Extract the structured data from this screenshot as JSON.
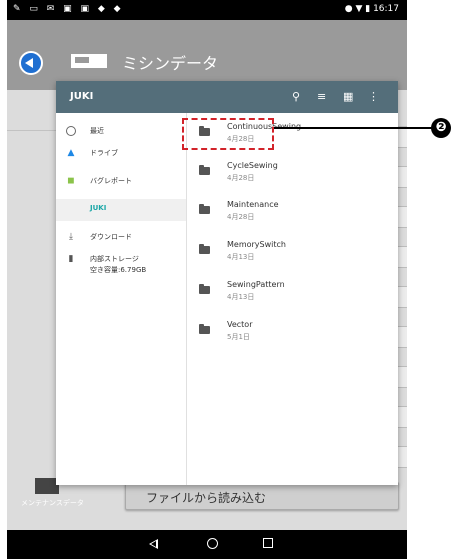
{
  "status_bar": {
    "left_icons": "✎ ▭ ✉ ▣ ▣ ◆ ◆",
    "time": "16:17"
  },
  "app": {
    "title": "ミシンデータ",
    "bottom_label": "メンテナンスデータ",
    "import_button": "ファイルから読み込む"
  },
  "dialog": {
    "title": "JUKI",
    "header_icons": [
      "search-icon",
      "sort-icon",
      "grid-icon",
      "more-icon"
    ],
    "drawer": [
      {
        "icon": "clock-icon",
        "label": "最近"
      },
      {
        "icon": "drive-icon",
        "label": "ドライブ"
      },
      {
        "icon": "android-icon",
        "label": "バグレポート"
      },
      {
        "icon": "",
        "label": "JUKI",
        "selected": true
      },
      {
        "icon": "download-icon",
        "label": "ダウンロード"
      },
      {
        "icon": "storage-icon",
        "label": "内部ストレージ",
        "sub": "空き容量:6.79GB"
      }
    ],
    "files": [
      {
        "name": "ContinuousSewing",
        "date": "4月28日"
      },
      {
        "name": "CycleSewing",
        "date": "4月28日"
      },
      {
        "name": "Maintenance",
        "date": "4月28日"
      },
      {
        "name": "MemorySwitch",
        "date": "4月13日"
      },
      {
        "name": "SewingPattern",
        "date": "4月13日"
      },
      {
        "name": "Vector",
        "date": "5月1日"
      }
    ]
  },
  "callout": {
    "number": "❷",
    "color": "#d2232a"
  },
  "colors": {
    "header": "#546e7a",
    "accent": "#1aa7a7",
    "back_button": "#1f6fd1"
  }
}
